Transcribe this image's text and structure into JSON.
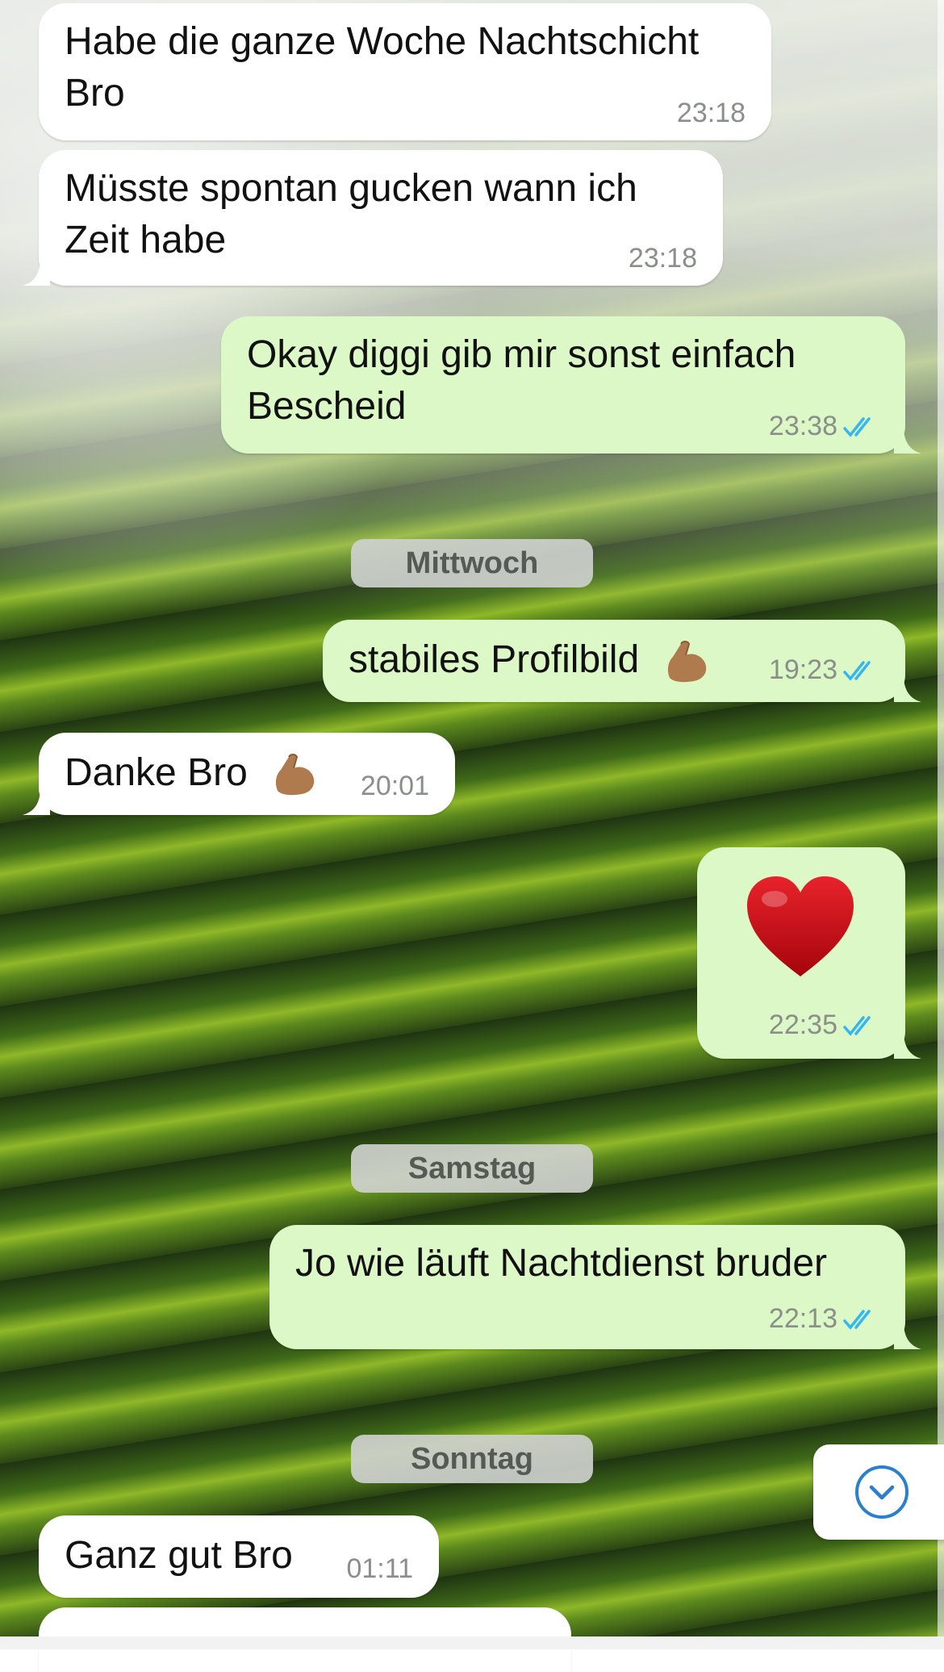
{
  "colors": {
    "incoming_bubble": "#ffffff",
    "outgoing_bubble": "#dcf8c6",
    "read_ticks": "#34b7f1",
    "scroll_icon": "#2a7fd1"
  },
  "messages": [
    {
      "text_lines": [
        "Habe die ganze Woche Nachtschicht",
        "Bro"
      ],
      "time": "23:18",
      "direction": "incoming"
    },
    {
      "text_lines": [
        "Müsste spontan gucken wann ich",
        "Zeit habe"
      ],
      "time": "23:18",
      "direction": "incoming"
    },
    {
      "text_lines": [
        "Okay diggi  gib mir sonst einfach",
        "Bescheid"
      ],
      "time": "23:38",
      "direction": "outgoing",
      "status": "read"
    },
    {
      "text": "stabiles Profilbild",
      "emoji": "flexed-biceps",
      "time": "19:23",
      "direction": "outgoing",
      "status": "read"
    },
    {
      "text": "Danke Bro",
      "emoji": "flexed-biceps",
      "time": "20:01",
      "direction": "incoming"
    },
    {
      "emoji": "red-heart",
      "time": "22:35",
      "direction": "outgoing",
      "status": "read"
    },
    {
      "text": "Jo wie läuft Nachtdienst bruder",
      "time": "22:13",
      "direction": "outgoing",
      "status": "read"
    },
    {
      "text": "Ganz gut Bro",
      "time": "01:11",
      "direction": "incoming"
    }
  ],
  "day_separators": [
    "Mittwoch",
    "Samstag",
    "Sonntag"
  ],
  "scroll_button": {
    "icon": "chevron-down-circle-icon"
  }
}
